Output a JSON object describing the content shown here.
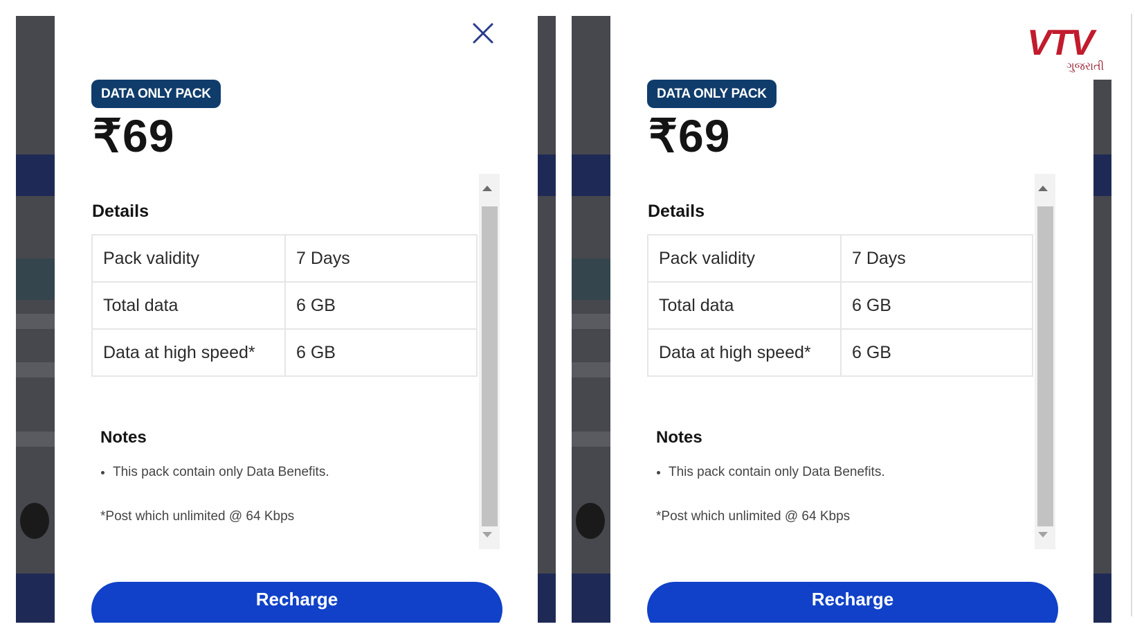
{
  "screens": [
    {
      "pack_badge": "DATA ONLY PACK",
      "price": "₹69",
      "details_title": "Details",
      "details": [
        {
          "label": "Pack validity",
          "value": "7 Days"
        },
        {
          "label": "Total data",
          "value": "6 GB"
        },
        {
          "label": "Data at high speed*",
          "value": "6 GB"
        }
      ],
      "notes_title": "Notes",
      "notes": [
        "This pack contain only Data Benefits."
      ],
      "footnote": "*Post which unlimited @ 64 Kbps",
      "recharge_label": "Recharge"
    },
    {
      "pack_badge": "DATA ONLY PACK",
      "price": "₹69",
      "details_title": "Details",
      "details": [
        {
          "label": "Pack validity",
          "value": "7 Days"
        },
        {
          "label": "Total data",
          "value": "6 GB"
        },
        {
          "label": "Data at high speed*",
          "value": "6 GB"
        }
      ],
      "notes_title": "Notes",
      "notes": [
        "This pack contain only Data Benefits."
      ],
      "footnote": "*Post which unlimited @ 64 Kbps",
      "recharge_label": "Recharge"
    }
  ],
  "logo": {
    "text": "VTV",
    "subtext": "ગુજરાતી"
  },
  "icons": {
    "close": "close-icon",
    "scroll_up": "scroll-up-arrow-icon",
    "scroll_down": "scroll-down-arrow-icon"
  },
  "colors": {
    "badge": "#0f3c6b",
    "button": "#1041c8",
    "close_icon": "#2a3a8c",
    "logo": "#c11b2d"
  }
}
